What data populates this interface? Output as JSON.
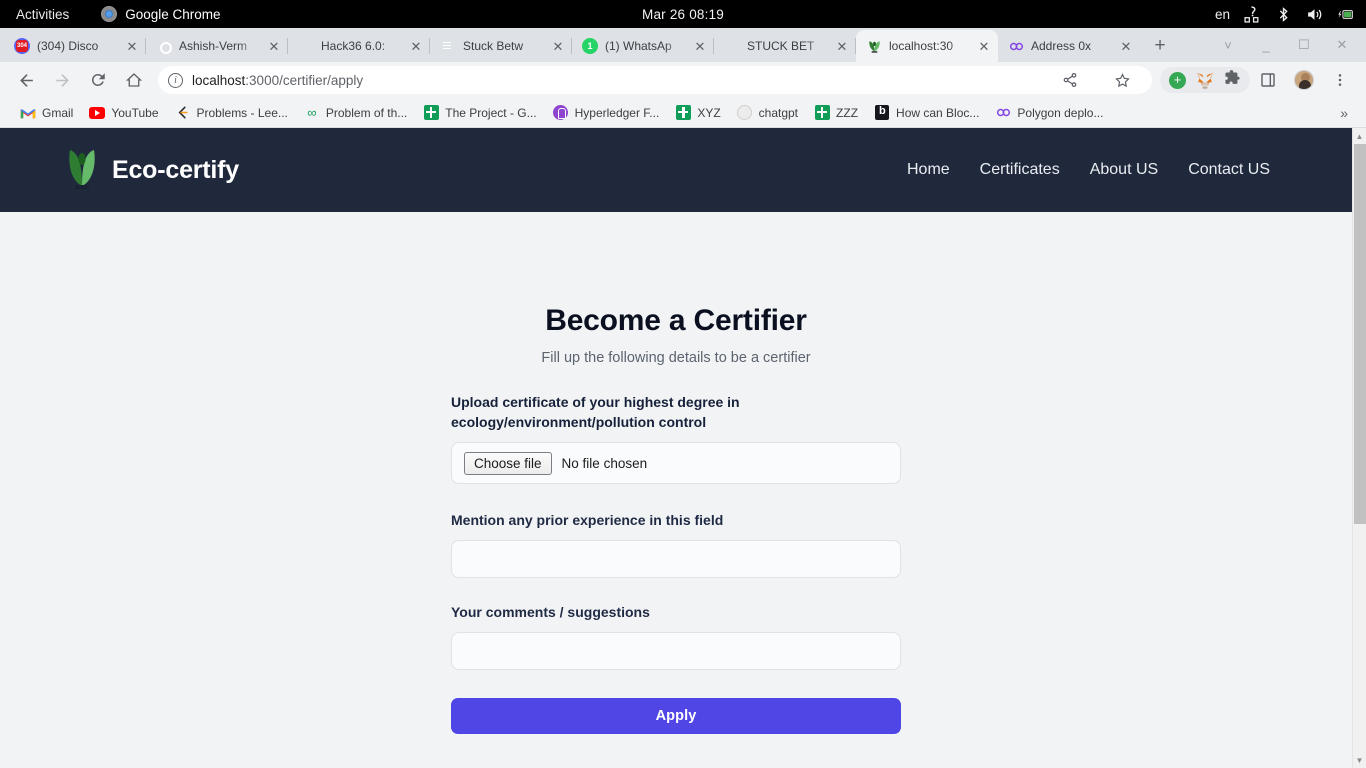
{
  "os_bar": {
    "activities": "Activities",
    "app_name": "Google Chrome",
    "app_icon": "chrome-icon",
    "clock": "Mar 26  08:19",
    "language": "en",
    "tray_icons": [
      "network-icon",
      "bluetooth-icon",
      "volume-icon",
      "battery-charging-icon"
    ]
  },
  "browser": {
    "tabs": [
      {
        "title": "(304) Disco",
        "favicon": "discord-icon",
        "active": false
      },
      {
        "title": "Ashish-Verm",
        "favicon": "github-icon",
        "active": false
      },
      {
        "title": "Hack36 6.0:",
        "favicon": "notion-icon",
        "active": false
      },
      {
        "title": "Stuck Betw",
        "favicon": "google-docs-icon",
        "active": false
      },
      {
        "title": "(1) WhatsAp",
        "favicon": "whatsapp-icon",
        "active": false
      },
      {
        "title": "STUCK BET",
        "favicon": "brave-icon",
        "active": false
      },
      {
        "title": "localhost:30",
        "favicon": "eco-certify-icon",
        "active": true
      },
      {
        "title": "Address 0x",
        "favicon": "polygonscan-icon",
        "active": false
      }
    ],
    "new_tab_label": "+",
    "window_controls": [
      "tab-search-chevron",
      "minimize",
      "maximize",
      "close"
    ],
    "nav": {
      "back": "back-arrow-icon",
      "forward": "forward-arrow-icon",
      "reload": "reload-icon",
      "home": "home-icon"
    },
    "omnibox": {
      "site_info_icon": "info-circle-icon",
      "url_host": "localhost",
      "url_path": ":3000/certifier/apply",
      "url_full": "localhost:3000/certifier/apply"
    },
    "omnibox_actions": [
      "share-icon",
      "bookmark-star-icon"
    ],
    "extensions": [
      "add-extension-icon",
      "metamask-icon",
      "puzzle-extensions-icon"
    ],
    "side_panel_icon": "side-panel-icon",
    "profile_avatar": "avatar",
    "menu_icon": "kebab-menu-icon",
    "bookmarks": [
      {
        "label": "Gmail",
        "icon": "gmail-icon"
      },
      {
        "label": "YouTube",
        "icon": "youtube-icon"
      },
      {
        "label": "Problems - Lee...",
        "icon": "leetcode-icon"
      },
      {
        "label": "Problem of th...",
        "icon": "infinity-icon"
      },
      {
        "label": "The Project - G...",
        "icon": "green-plus-icon"
      },
      {
        "label": "Hyperledger F...",
        "icon": "hyperledger-icon"
      },
      {
        "label": "XYZ",
        "icon": "green-plus-icon"
      },
      {
        "label": "chatgpt",
        "icon": "chatgpt-icon"
      },
      {
        "label": "ZZZ",
        "icon": "green-plus-icon"
      },
      {
        "label": "How can Bloc...",
        "icon": "blog-icon"
      },
      {
        "label": "Polygon deplo...",
        "icon": "polygonscan-icon"
      }
    ],
    "bookmarks_overflow": "»"
  },
  "site": {
    "brand_name": "Eco-certify",
    "brand_icon": "leaf-logo-icon",
    "nav": [
      {
        "label": "Home"
      },
      {
        "label": "Certificates"
      },
      {
        "label": "About US"
      },
      {
        "label": "Contact US"
      }
    ]
  },
  "main": {
    "title": "Become a Certifier",
    "subtitle": "Fill up the following details to be a certifier",
    "fields": [
      {
        "label": "Upload certificate of your highest degree in ecology/environment/pollution control",
        "type": "file",
        "button_label": "Choose file",
        "status": "No file chosen"
      },
      {
        "label": "Mention any prior experience in this field",
        "type": "text",
        "value": "",
        "placeholder": ""
      },
      {
        "label": "Your comments / suggestions",
        "type": "text",
        "value": "",
        "placeholder": ""
      }
    ],
    "submit_label": "Apply"
  },
  "colors": {
    "header_bg": "#20293c",
    "page_bg": "#f2f3f5",
    "accent": "#4f46e5",
    "leaf_green": "#4caf50"
  }
}
